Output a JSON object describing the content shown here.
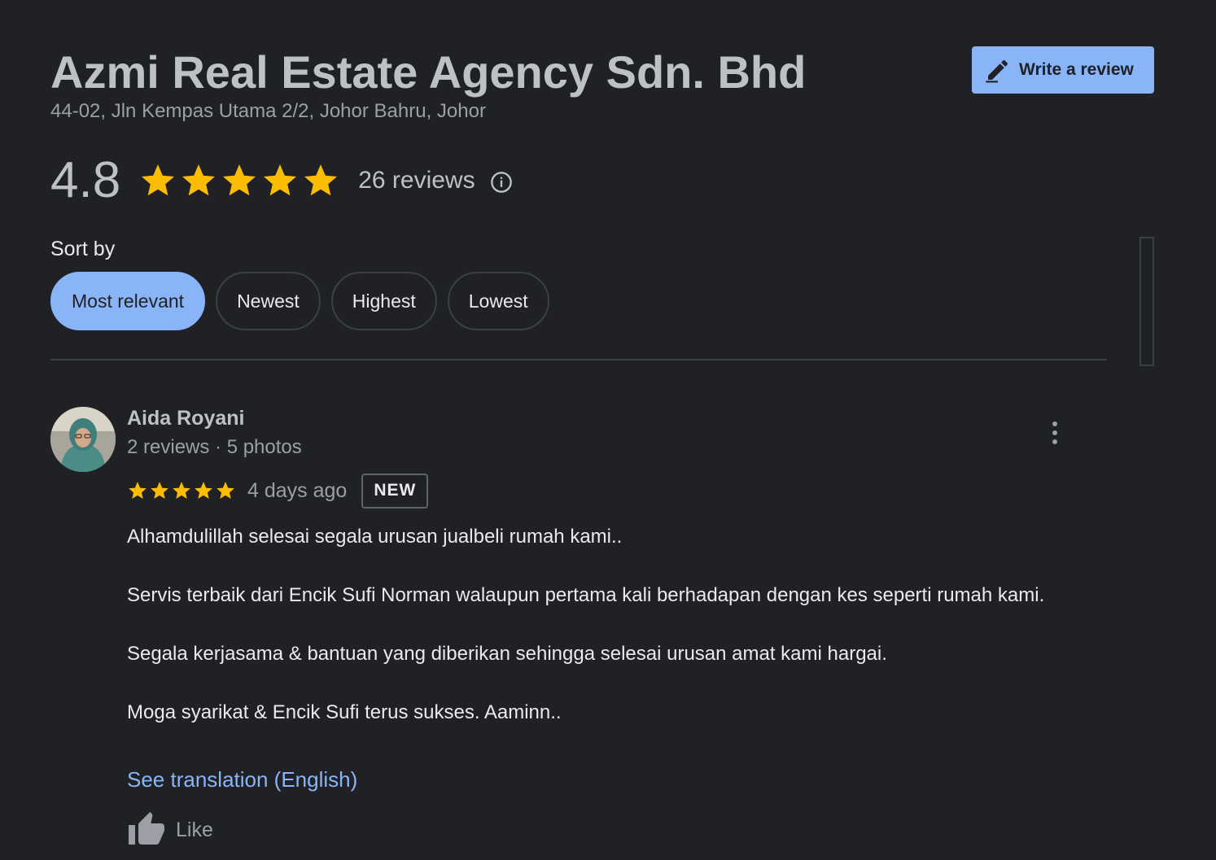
{
  "place": {
    "name": "Azmi Real Estate Agency Sdn. Bhd",
    "address": "44-02, Jln Kempas Utama 2/2, Johor Bahru, Johor"
  },
  "write_review": {
    "label": "Write a review",
    "icon": "pencil-icon"
  },
  "summary": {
    "rating": "4.8",
    "stars": 5,
    "review_count": "26 reviews",
    "info_icon": "info-icon"
  },
  "sort": {
    "label": "Sort by",
    "options": [
      "Most relevant",
      "Newest",
      "Highest",
      "Lowest"
    ],
    "selected": "Most relevant"
  },
  "review": {
    "author": "Aida Royani",
    "author_meta": "2 reviews · 5 photos",
    "stars": 5,
    "date": "4 days ago",
    "badge": "NEW",
    "paragraphs": [
      "Alhamdulillah selesai segala urusan jualbeli rumah kami..",
      "Servis terbaik dari Encik Sufi Norman walaupun pertama kali berhadapan dengan kes seperti rumah kami.",
      "Segala kerjasama & bantuan yang diberikan sehingga selesai urusan amat kami hargai.",
      "Moga syarikat & Encik Sufi terus sukses. Aaminn.."
    ],
    "translate_label": "See translation (English)",
    "like_label": "Like"
  },
  "colors": {
    "background": "#202124",
    "accent": "#8ab4f8",
    "star": "#fbbc04",
    "text_secondary": "#9aa0a6"
  }
}
